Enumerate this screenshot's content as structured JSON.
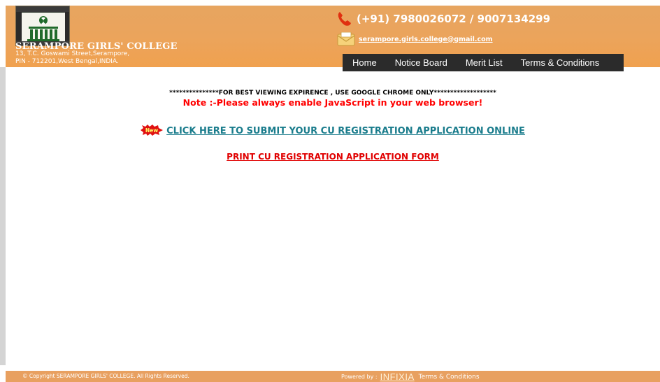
{
  "header": {
    "college_name": "SERAMPORE GIRLS' COLLEGE",
    "address_line1": "13, T.C. Goswami Street,Serampore,",
    "address_line2": "PIN - 712201,West Bengal,INDIA.",
    "phone": "(+91) 7980026072 / 9007134299",
    "email": "serampore.girls.college@gmail.com"
  },
  "nav": {
    "items": [
      {
        "label": "Home"
      },
      {
        "label": "Notice Board"
      },
      {
        "label": "Merit List"
      },
      {
        "label": "Terms & Conditions"
      }
    ]
  },
  "main": {
    "browser_notice": "***************FOR BEST VIEWING EXPIRENCE , USE GOOGLE CHROME ONLY*******************",
    "js_note": "Note :-Please always enable JavaScript in your web browser!",
    "new_badge": "New",
    "submit_link": "CLICK HERE TO SUBMIT YOUR CU REGISTRATION APPLICATION ONLINE",
    "print_link": "PRINT CU REGISTRATION APPLICATION FORM"
  },
  "footer": {
    "copyright": "© Copyright SERAMPORE GIRLS' COLLEGE. All Rights Reserved.",
    "powered_by": "Powered by :",
    "brand": "INFIXIA",
    "terms": "Terms & Conditions"
  },
  "colors": {
    "header_orange": "#eba45c",
    "nav_bg": "#2b2b2b",
    "submit_link": "#1a7c8c",
    "alert_red": "#ff0000"
  },
  "icons": [
    "college-logo",
    "phone-icon",
    "mail-icon",
    "new-badge-icon"
  ]
}
